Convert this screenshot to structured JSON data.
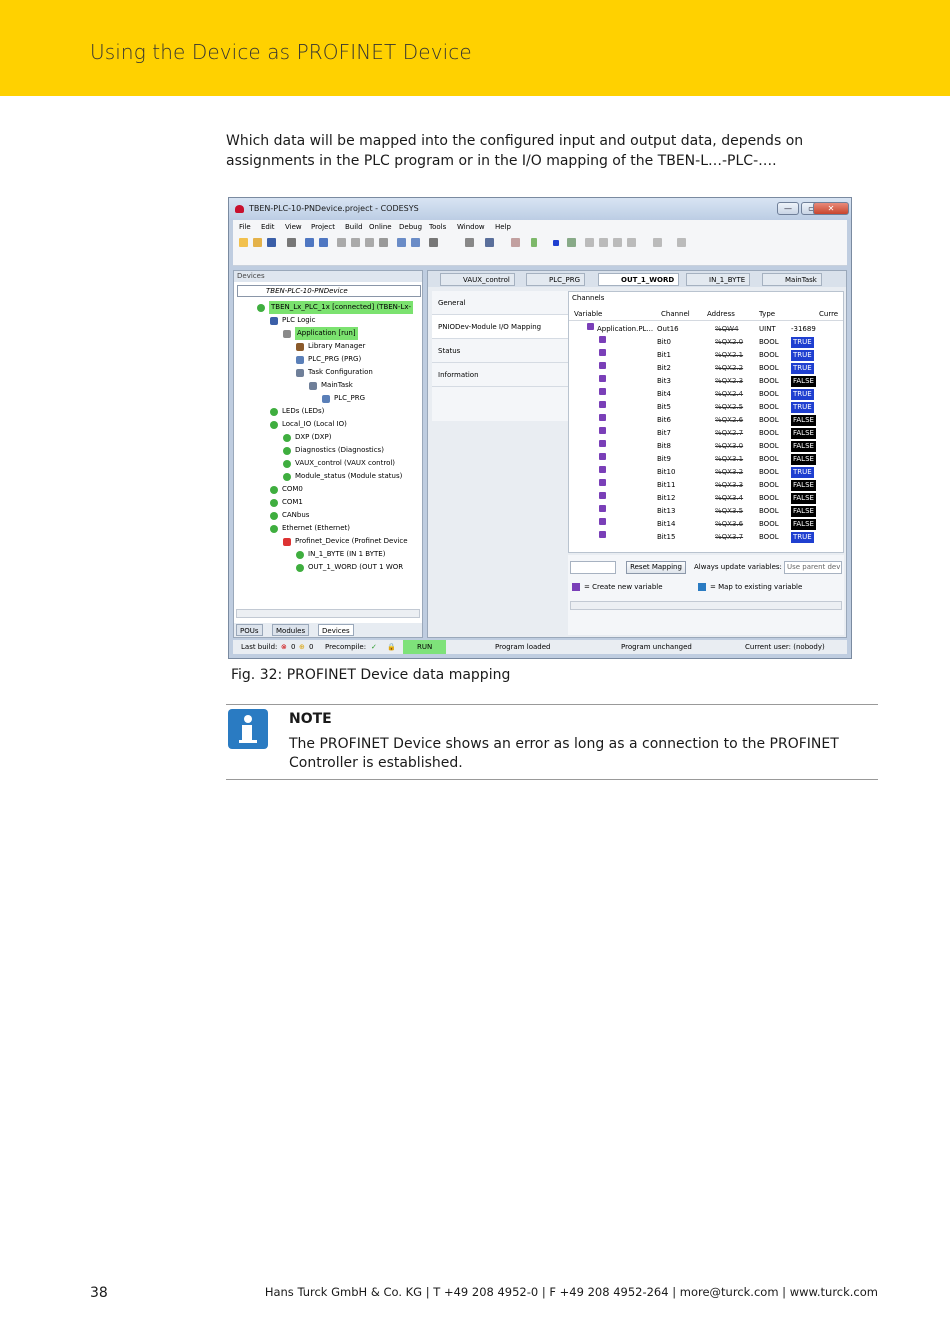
{
  "header": {
    "title": "Using the Device as PROFINET Device"
  },
  "intro": "Which data will be mapped into the configured input and output data, depends on assignments in the PLC program or in the I/O mapping of the TBEN-L…-PLC-….",
  "screenshot": {
    "window_title": "TBEN-PLC-10-PNDevice.project - CODESYS",
    "window_buttons": [
      "—",
      "▭",
      "✕"
    ],
    "menu": [
      "File",
      "Edit",
      "View",
      "Project",
      "Build",
      "Online",
      "Debug",
      "Tools",
      "Window",
      "Help"
    ],
    "devices_panel": {
      "header": "Devices",
      "root": "TBEN-PLC-10-PNDevice",
      "tree": [
        {
          "label": "TBEN_Lx_PLC_1x [connected] (TBEN-Lx-",
          "level": 1,
          "highlight": true,
          "icon": "green"
        },
        {
          "label": "PLC Logic",
          "level": 2,
          "highlight": false,
          "icon": "blue"
        },
        {
          "label": "Application [run]",
          "level": 3,
          "highlight": true,
          "icon": "gray"
        },
        {
          "label": "Library Manager",
          "level": 4,
          "highlight": false,
          "icon": "book"
        },
        {
          "label": "PLC_PRG (PRG)",
          "level": 4,
          "highlight": false,
          "icon": "doc"
        },
        {
          "label": "Task Configuration",
          "level": 4,
          "highlight": false,
          "icon": "gear"
        },
        {
          "label": "MainTask",
          "level": 5,
          "highlight": false,
          "icon": "gear"
        },
        {
          "label": "PLC_PRG",
          "level": 6,
          "highlight": false,
          "icon": "doc"
        },
        {
          "label": "LEDs (LEDs)",
          "level": 2,
          "highlight": false,
          "icon": "green"
        },
        {
          "label": "Local_IO (Local IO)",
          "level": 2,
          "highlight": false,
          "icon": "green"
        },
        {
          "label": "DXP (DXP)",
          "level": 3,
          "highlight": false,
          "icon": "green"
        },
        {
          "label": "Diagnostics (Diagnostics)",
          "level": 3,
          "highlight": false,
          "icon": "green"
        },
        {
          "label": "VAUX_control (VAUX control)",
          "level": 3,
          "highlight": false,
          "icon": "green"
        },
        {
          "label": "Module_status (Module status)",
          "level": 3,
          "highlight": false,
          "icon": "green"
        },
        {
          "label": "COM0",
          "level": 2,
          "highlight": false,
          "icon": "green"
        },
        {
          "label": "COM1",
          "level": 2,
          "highlight": false,
          "icon": "green"
        },
        {
          "label": "CANbus",
          "level": 2,
          "highlight": false,
          "icon": "green"
        },
        {
          "label": "Ethernet (Ethernet)",
          "level": 2,
          "highlight": false,
          "icon": "green"
        },
        {
          "label": "Profinet_Device (Profinet Device",
          "level": 3,
          "highlight": false,
          "icon": "warn"
        },
        {
          "label": "IN_1_BYTE (IN 1 BYTE)",
          "level": 4,
          "highlight": false,
          "icon": "green"
        },
        {
          "label": "OUT_1_WORD (OUT 1 WOR",
          "level": 4,
          "highlight": false,
          "icon": "green"
        }
      ],
      "bottom_tabs": [
        "POUs",
        "Modules",
        "Devices"
      ]
    },
    "editor_tabs": [
      "VAUX_control",
      "PLC_PRG",
      "OUT_1_WORD",
      "IN_1_BYTE",
      "MainTask"
    ],
    "active_tab": "OUT_1_WORD",
    "side_nav": [
      "General",
      "PNIODev-Module I/O Mapping",
      "Status",
      "Information"
    ],
    "channels": {
      "title": "Channels",
      "columns": [
        "Variable",
        "Channel",
        "Address",
        "Type",
        "Curre"
      ],
      "rows": [
        {
          "variable": "Application.PL...",
          "channel": "Out16",
          "address": "%QW4",
          "type": "UINT",
          "value": "-31689",
          "state": "plain"
        },
        {
          "variable": "",
          "channel": "Bit0",
          "address": "%QX2.0",
          "type": "BOOL",
          "value": "TRUE",
          "state": "true"
        },
        {
          "variable": "",
          "channel": "Bit1",
          "address": "%QX2.1",
          "type": "BOOL",
          "value": "TRUE",
          "state": "true"
        },
        {
          "variable": "",
          "channel": "Bit2",
          "address": "%QX2.2",
          "type": "BOOL",
          "value": "TRUE",
          "state": "true"
        },
        {
          "variable": "",
          "channel": "Bit3",
          "address": "%QX2.3",
          "type": "BOOL",
          "value": "FALSE",
          "state": "false"
        },
        {
          "variable": "",
          "channel": "Bit4",
          "address": "%QX2.4",
          "type": "BOOL",
          "value": "TRUE",
          "state": "true"
        },
        {
          "variable": "",
          "channel": "Bit5",
          "address": "%QX2.5",
          "type": "BOOL",
          "value": "TRUE",
          "state": "true"
        },
        {
          "variable": "",
          "channel": "Bit6",
          "address": "%QX2.6",
          "type": "BOOL",
          "value": "FALSE",
          "state": "false"
        },
        {
          "variable": "",
          "channel": "Bit7",
          "address": "%QX2.7",
          "type": "BOOL",
          "value": "FALSE",
          "state": "false"
        },
        {
          "variable": "",
          "channel": "Bit8",
          "address": "%QX3.0",
          "type": "BOOL",
          "value": "FALSE",
          "state": "false"
        },
        {
          "variable": "",
          "channel": "Bit9",
          "address": "%QX3.1",
          "type": "BOOL",
          "value": "FALSE",
          "state": "false"
        },
        {
          "variable": "",
          "channel": "Bit10",
          "address": "%QX3.2",
          "type": "BOOL",
          "value": "TRUE",
          "state": "true"
        },
        {
          "variable": "",
          "channel": "Bit11",
          "address": "%QX3.3",
          "type": "BOOL",
          "value": "FALSE",
          "state": "false"
        },
        {
          "variable": "",
          "channel": "Bit12",
          "address": "%QX3.4",
          "type": "BOOL",
          "value": "FALSE",
          "state": "false"
        },
        {
          "variable": "",
          "channel": "Bit13",
          "address": "%QX3.5",
          "type": "BOOL",
          "value": "FALSE",
          "state": "false"
        },
        {
          "variable": "",
          "channel": "Bit14",
          "address": "%QX3.6",
          "type": "BOOL",
          "value": "FALSE",
          "state": "false"
        },
        {
          "variable": "",
          "channel": "Bit15",
          "address": "%QX3.7",
          "type": "BOOL",
          "value": "TRUE",
          "state": "true"
        }
      ],
      "reset_button": "Reset Mapping",
      "always_update_label": "Always update variables:",
      "always_update_value": "Use parent devi",
      "legend_new": "= Create new variable",
      "legend_existing": "= Map to existing variable"
    },
    "status_bar": {
      "last_build": "Last build:",
      "errors": "0",
      "warnings": "0",
      "precompile": "Precompile:",
      "run": "RUN",
      "program_loaded": "Program loaded",
      "program_unchanged": "Program unchanged",
      "current_user": "Current user: (nobody)"
    }
  },
  "caption": "Fig. 32: PROFINET Device data mapping",
  "note": {
    "title": "NOTE",
    "text": "The PROFINET Device shows an error as long as a connection to the PROFINET Controller is established."
  },
  "footer": {
    "page": "38",
    "company": "Hans Turck GmbH & Co. KG | T +49 208 4952-0 | F +49 208 4952-264 | more@turck.com | www.turck.com"
  },
  "colors": {
    "header_bg": "#ffd100",
    "note_icon": "#2a7bc2",
    "true_bg": "#1f3fd0",
    "false_bg": "#000000",
    "highlight": "#7be26f"
  }
}
